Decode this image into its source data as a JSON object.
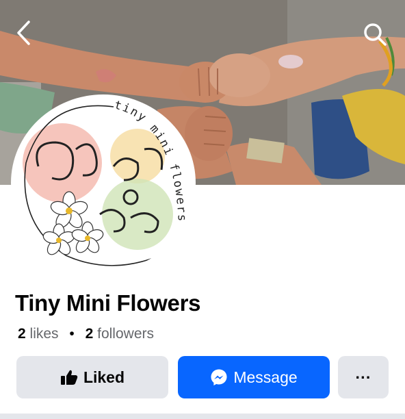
{
  "header": {
    "back_icon": "chevron-left-icon",
    "search_icon": "search-icon"
  },
  "profile": {
    "name": "Tiny Mini Flowers",
    "likes_count": "2",
    "likes_label": "likes",
    "separator": "•",
    "followers_count": "2",
    "followers_label": "followers",
    "logo_text": "tiny mini flowers"
  },
  "actions": {
    "liked_label": "Liked",
    "liked_icon": "thumbs-up-icon",
    "message_label": "Message",
    "message_icon": "messenger-icon",
    "more_label": "···",
    "more_icon": "more-horizontal-icon"
  },
  "colors": {
    "primary_button": "#0866ff",
    "secondary_button": "#e4e6eb",
    "title_text": "#050505",
    "meta_text": "#65676b"
  }
}
